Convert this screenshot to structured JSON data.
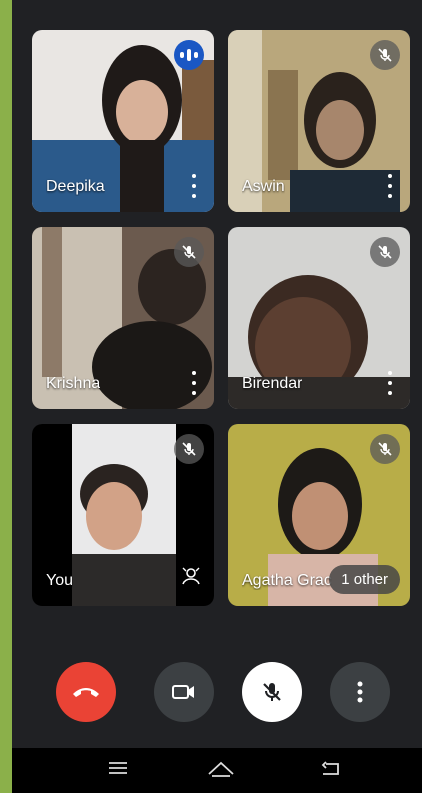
{
  "participants": [
    {
      "name": "Deepika",
      "status": "speaking"
    },
    {
      "name": "Aswin",
      "status": "muted"
    },
    {
      "name": "Krishna",
      "status": "muted"
    },
    {
      "name": "Birendar",
      "status": "muted"
    },
    {
      "name": "You",
      "status": "muted"
    },
    {
      "name": "Agatha Grac",
      "status": "muted"
    }
  ],
  "overflow": {
    "label": "1 other"
  },
  "controls": [
    "end-call",
    "camera",
    "microphone-muted",
    "more-options"
  ],
  "colors": {
    "end_call": "#ea4335",
    "speaking": "#1a57c4",
    "accent_border": "#8bb04a"
  }
}
